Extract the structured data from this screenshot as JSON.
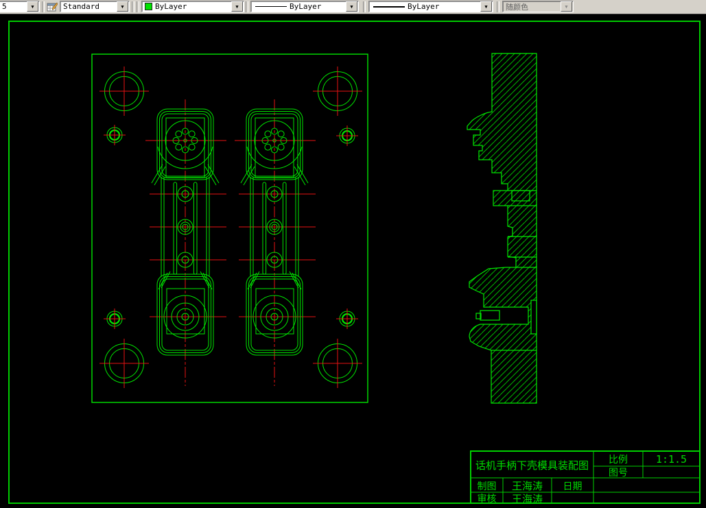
{
  "toolbar": {
    "dim_style_value": "5",
    "table_style_value": "Standard",
    "color_value": "ByLayer",
    "linetype_value": "ByLayer",
    "lineweight_value": "ByLayer",
    "plot_style_value": "随颜色",
    "arrow_glyph": "▼",
    "swatch_color": "#00e400"
  },
  "title_block": {
    "title": "话机手柄下壳模具装配图",
    "scale_label": "比例",
    "scale_value": "1:1.5",
    "drawing_no_label": "图号",
    "drawing_no_value": "",
    "drawn_label": "制图",
    "drawn_value": "王海涛",
    "date_label": "日期",
    "date_value": "",
    "checked_label": "审核",
    "checked_value": "王海涛"
  },
  "colors": {
    "drawing_green": "#00e800",
    "hatch_green": "#00b800",
    "frame_green": "#00cc00",
    "centerline_red": "#e81212",
    "canvas_black": "#000000",
    "toolbar_gray": "#d5d1c9"
  }
}
